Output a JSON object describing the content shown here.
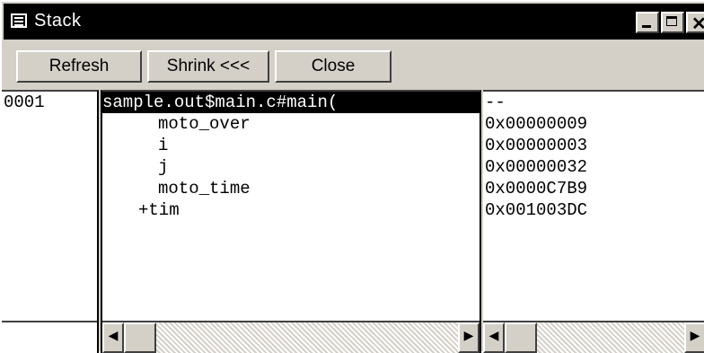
{
  "window": {
    "title": "Stack",
    "icon": "list-window-icon"
  },
  "toolbar": {
    "refresh_label": "Refresh",
    "shrink_label": "Shrink <<<",
    "close_label": "Close"
  },
  "stack": {
    "frame_id": "0001",
    "frame_label": "sample.out$main.c#main(",
    "frame_value": "--",
    "locals": [
      {
        "name": "moto_over",
        "value": "0x00000009"
      },
      {
        "name": "i",
        "value": "0x00000003"
      },
      {
        "name": "j",
        "value": "0x00000032"
      },
      {
        "name": "moto_time",
        "value": "0x0000C7B9"
      },
      {
        "name": "+tim",
        "value": "0x001003DC"
      }
    ]
  },
  "colors": {
    "selection_bg": "#000000",
    "window_face": "#d4d0c8"
  }
}
